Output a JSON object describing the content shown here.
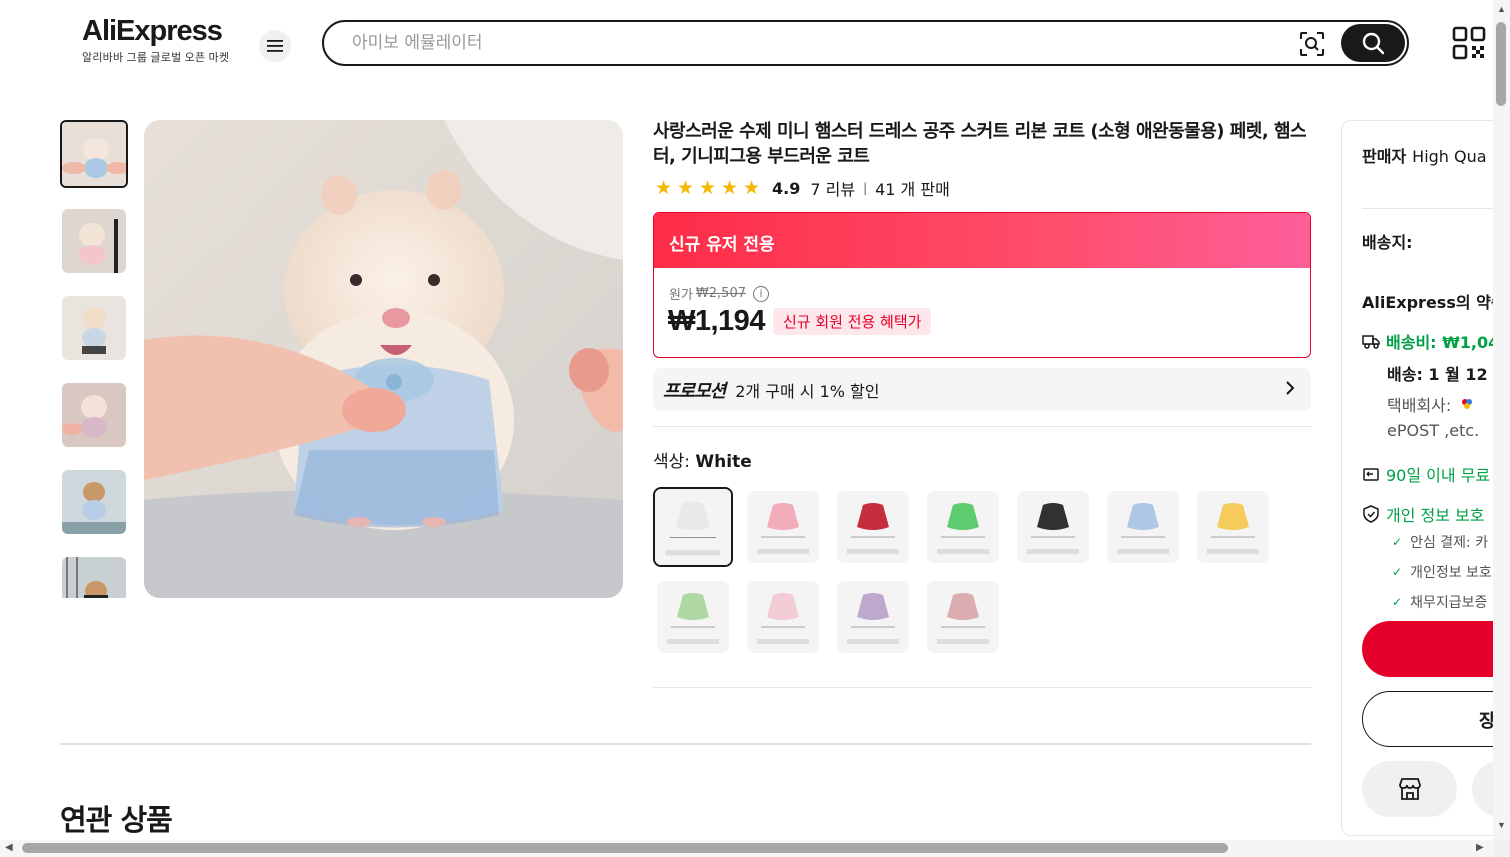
{
  "header": {
    "logo_text": "AliExpress",
    "logo_tagline": "알리바바 그룹 글로벌 오픈 마켓",
    "search_placeholder": "아미보 에뮬레이터"
  },
  "product": {
    "title": "사랑스러운 수제 미니 햄스터 드레스 공주 스커트 리본 코트 (소형 애완동물용) 페렛, 햄스터, 기니피그용 부드러운 코트",
    "rating": "4.9",
    "reviews": "7 리뷰",
    "sold": "41 개 판매",
    "stars": 5,
    "deal_header": "신규 유저 전용",
    "original_label": "원가",
    "original_price": "₩2,507",
    "price": "₩1,194",
    "new_member_badge": "신규 회원 전용 혜택가",
    "promo_label": "프로모션",
    "promo_text": "2개 구매 시 1% 할인",
    "color_label": "색상:",
    "color_value": "White",
    "swatch_count": 11
  },
  "related": {
    "title": "연관 상품"
  },
  "panel": {
    "seller_label": "판매자",
    "seller_value": "High Qua",
    "ship_to_label": "배송지:",
    "promise_label": "AliExpress의 약속",
    "shipping_fee": "배송비: ₩1,04",
    "delivery": "배송: 1 월 12",
    "carrier_label": "택배회사:",
    "carrier_value": "ePOST ,etc.",
    "return_text": "90일 이내 무료",
    "privacy_text": "개인 정보 보호",
    "check1": "안심 결제: 카",
    "check2": "개인정보 보호",
    "check3": "채무지급보증",
    "cart_label": "장"
  },
  "colors": {
    "accent_red": "#e5002b",
    "green": "#00a046",
    "star": "#f5b800"
  }
}
